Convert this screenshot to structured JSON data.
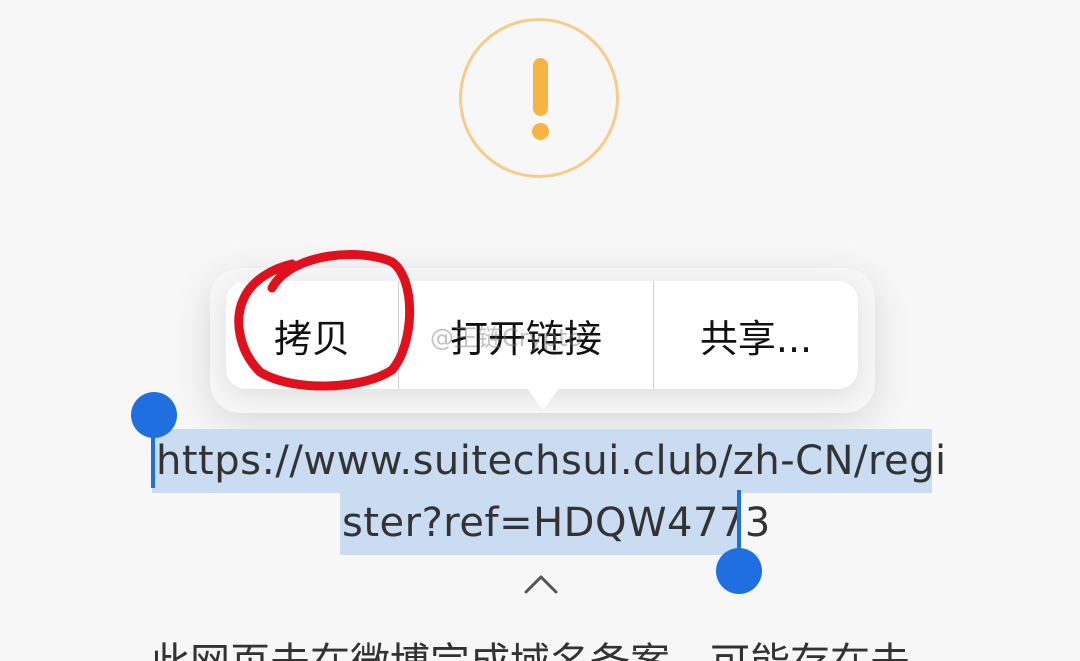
{
  "warning": {
    "icon": "exclamation-icon"
  },
  "context_menu": {
    "items": [
      {
        "label": "拷贝"
      },
      {
        "label": "打开链接"
      },
      {
        "label": "共享..."
      }
    ]
  },
  "watermark": "@王链Crypto",
  "link": {
    "line1": "https://www.suitechsui.club/zh-CN/regi",
    "line2": "ster?ref=HDQW4773"
  },
  "bottom_text": "此网页未在微博完成域名备案，可能存在未",
  "colors": {
    "warning": "#f6b443",
    "selection": "#c9dcf2",
    "handle": "#1f6fe0",
    "annotation": "#e0101c"
  }
}
